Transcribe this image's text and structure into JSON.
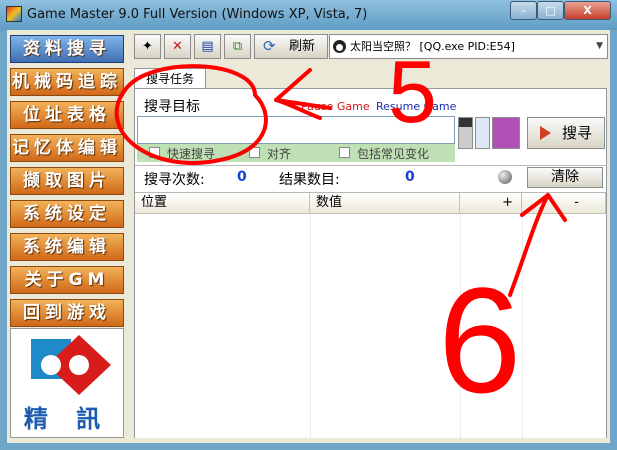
{
  "window": {
    "title": "Game Master 9.0 Full Version (Windows XP, Vista, 7)",
    "controls": {
      "minimize": "–",
      "maximize": "□",
      "close": "X"
    }
  },
  "sidebar": {
    "items": [
      {
        "label": "资料搜寻",
        "active": true
      },
      {
        "label": "机械码追踪",
        "active": false
      },
      {
        "label": "位址表格",
        "active": false
      },
      {
        "label": "记忆体编辑",
        "active": false
      },
      {
        "label": "撷取图片",
        "active": false
      },
      {
        "label": "系统设定",
        "active": false
      },
      {
        "label": "系统编辑",
        "active": false
      },
      {
        "label": "关于GM",
        "active": false
      },
      {
        "label": "回到游戏",
        "active": false
      }
    ],
    "logo_text": "精 訊"
  },
  "toolbar": {
    "refresh_label": "刷新",
    "process": "太阳当空照？ [QQ.exe PID:E54]"
  },
  "tabs": {
    "search": "搜寻任务"
  },
  "search_panel": {
    "target_label": "搜寻目标",
    "pause_label": "Pause Game",
    "resume_label": "Resume Game",
    "target_value": "",
    "options": [
      {
        "label": "快速搜寻",
        "checked": false
      },
      {
        "label": "对齐",
        "checked": false
      },
      {
        "label": "包括常见变化",
        "checked": false
      }
    ],
    "search_button": "搜寻",
    "search_count_label": "搜寻次数:",
    "search_count": "0",
    "result_count_label": "结果数目:",
    "result_count": "0",
    "clear_button": "清除"
  },
  "results_table": {
    "columns": [
      "位置",
      "数值",
      "+",
      "-"
    ],
    "rows": []
  },
  "annotations": {
    "arrow_label_1": "5",
    "arrow_label_2": "6",
    "color": "#ff0000"
  }
}
